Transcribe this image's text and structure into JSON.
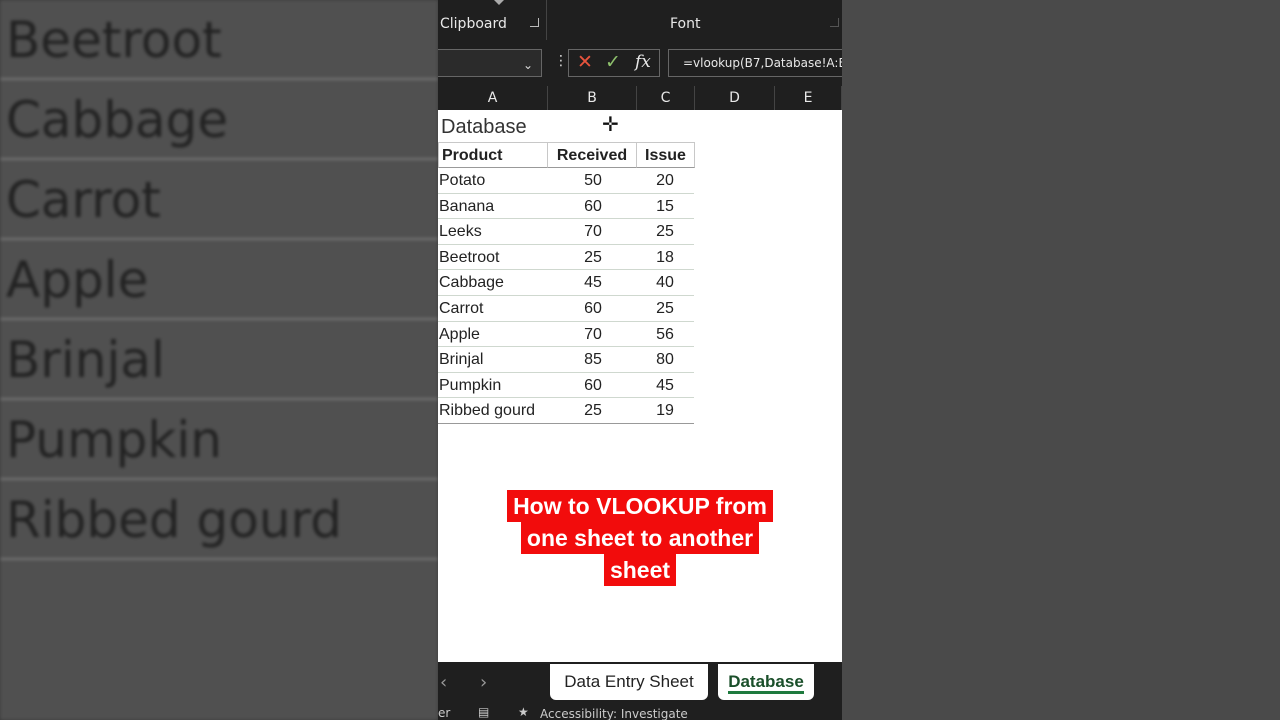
{
  "background_list": [
    "Beetroot",
    "Cabbage",
    "Carrot",
    "Apple",
    "Brinjal",
    "Pumpkin",
    "Ribbed gourd"
  ],
  "ribbon": {
    "clipboard": "Clipboard",
    "font": "Font"
  },
  "formula_bar": {
    "formula": "=vlookup(B7,Database!A:B",
    "fx": "fx"
  },
  "columns": [
    "A",
    "B",
    "C",
    "D",
    "E"
  ],
  "sheet": {
    "title": "Database",
    "headers": [
      "Product",
      "Received",
      "Issue"
    ],
    "rows": [
      [
        "Potato",
        "50",
        "20"
      ],
      [
        "Banana",
        "60",
        "15"
      ],
      [
        "Leeks",
        "70",
        "25"
      ],
      [
        "Beetroot",
        "25",
        "18"
      ],
      [
        "Cabbage",
        "45",
        "40"
      ],
      [
        "Carrot",
        "60",
        "25"
      ],
      [
        "Apple",
        "70",
        "56"
      ],
      [
        "Brinjal",
        "85",
        "80"
      ],
      [
        "Pumpkin",
        "60",
        "45"
      ],
      [
        "Ribbed gourd",
        "25",
        "19"
      ]
    ]
  },
  "caption": [
    "How to VLOOKUP from",
    "one sheet to another",
    "sheet"
  ],
  "tabs": [
    "Data Entry Sheet",
    "Database"
  ],
  "status": {
    "left": "er",
    "accessibility": "Accessibility: Investigate"
  },
  "colors": {
    "caption_bg": "#f20c0c",
    "active_tab": "#1e7a3e",
    "cancel": "#e8543d",
    "enter": "#8ec06c"
  },
  "icons": [
    "cursor-cross-icon",
    "cancel-x-icon",
    "enter-check-icon",
    "fx-icon",
    "chevron-down-icon",
    "chevron-left-icon",
    "chevron-right-icon",
    "launcher-icon",
    "accessibility-icon"
  ]
}
